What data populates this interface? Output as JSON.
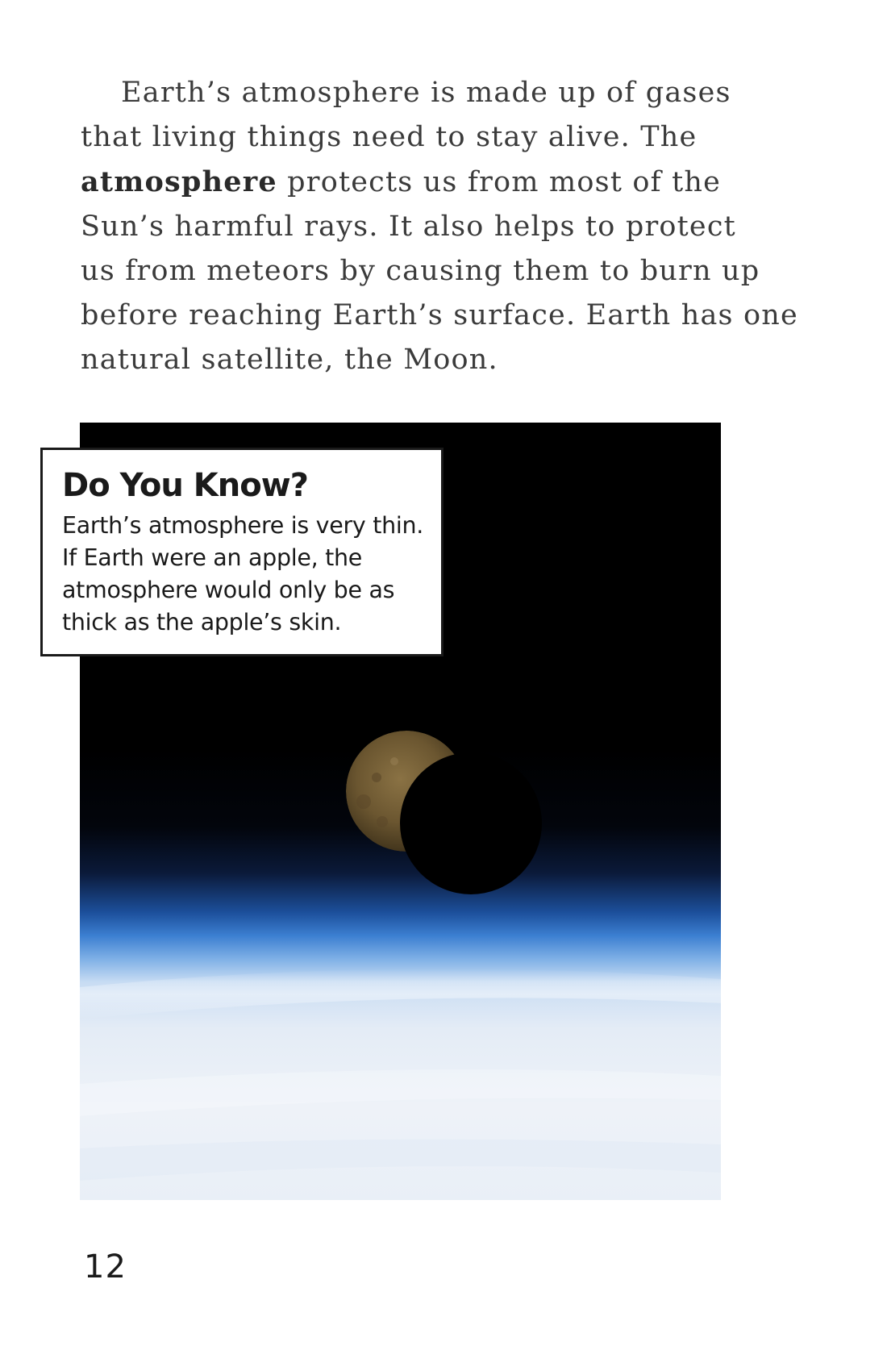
{
  "paragraph": {
    "line1": "Earth’s atmosphere is made up of gases",
    "line2": "that living things need to stay alive. The",
    "line3_bold": "atmosphere",
    "line3_rest": " protects us from most of the",
    "line4": "Sun’s harmful rays. It also helps to protect",
    "line5": "us from meteors by causing them to burn up",
    "line6": "before reaching Earth’s surface. Earth has one",
    "line7": "natural satellite, the Moon."
  },
  "callout": {
    "title": "Do You Know?",
    "line1": "Earth’s atmosphere is very thin.",
    "line2": "If Earth were an apple, the",
    "line3": "atmosphere would only be as",
    "line4": "thick as the apple’s skin."
  },
  "photo": {
    "subject": "moon-over-earth-atmosphere"
  },
  "page_number": "12"
}
